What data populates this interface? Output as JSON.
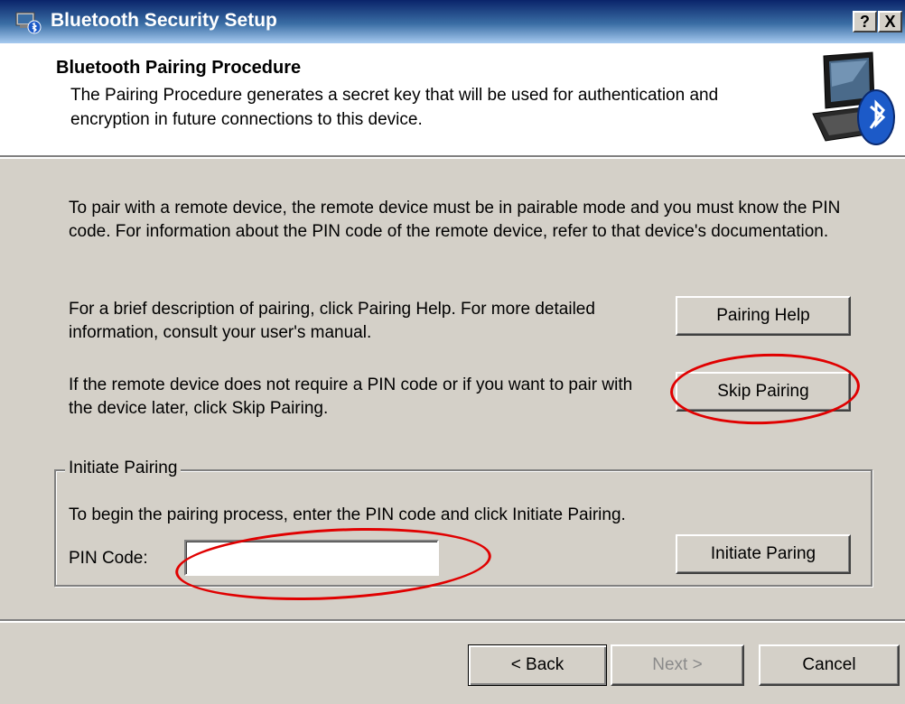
{
  "window": {
    "title": "Bluetooth Security Setup",
    "help_label": "?",
    "close_label": "X"
  },
  "header": {
    "title": "Bluetooth Pairing Procedure",
    "description": "The Pairing Procedure generates a secret key that will be used for authentication and encryption in future connections to this device."
  },
  "body": {
    "paragraph1": "To pair with a remote device, the remote device must be in pairable mode and you must know the PIN code.  For information about the PIN code of the remote device, refer to that device's documentation.",
    "paragraph2": "For a brief description of pairing, click Pairing Help.  For more detailed information, consult your user's manual.",
    "paragraph3": "If the remote device does not require a PIN code or if you want to pair with the device later, click Skip Pairing.",
    "pairing_help_label": "Pairing Help",
    "skip_pairing_label": "Skip Pairing"
  },
  "initiate_group": {
    "label": "Initiate Pairing",
    "description": "To begin the pairing process, enter the PIN code and click Initiate Pairing.",
    "pin_label": "PIN Code:",
    "pin_value": "",
    "initiate_label": "Initiate Paring"
  },
  "footer": {
    "back_label": "< Back",
    "next_label": "Next >",
    "cancel_label": "Cancel"
  },
  "annotation_color": "#e00000"
}
